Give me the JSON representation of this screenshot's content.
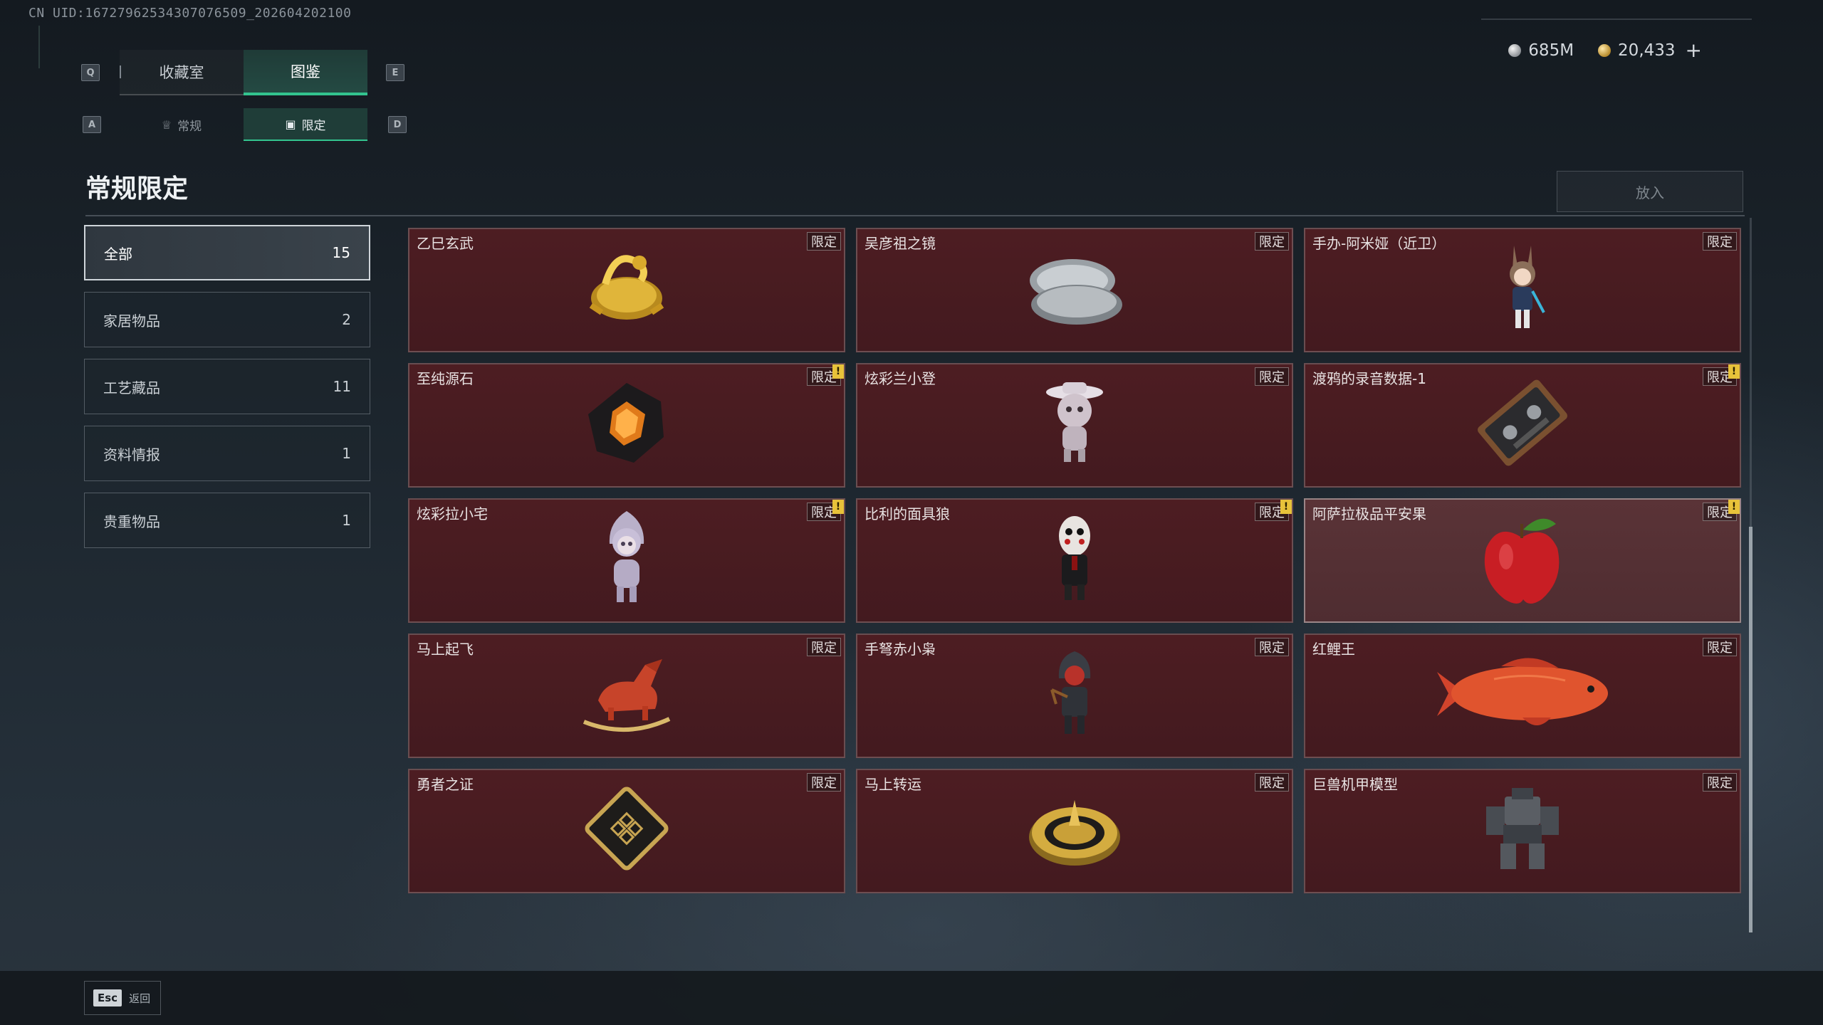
{
  "uid_text": "CN UID:16727962534307076509⁠⁠_202604202100",
  "currency": {
    "silver": "685M",
    "gold": "20,433",
    "add": "+"
  },
  "keys": {
    "prev_tab": "Q",
    "next_tab": "E",
    "prev_sub": "A",
    "next_sub": "D"
  },
  "main_tabs": [
    {
      "label": "收藏室"
    },
    {
      "label": "图鉴"
    }
  ],
  "sub_tabs": [
    {
      "label": "常规",
      "icon": "trophy-icon"
    },
    {
      "label": "限定",
      "icon": "picture-icon"
    }
  ],
  "heading": "常规限定",
  "put_button": "放入",
  "categories": [
    {
      "label": "全部",
      "count": "15"
    },
    {
      "label": "家居物品",
      "count": "2"
    },
    {
      "label": "工艺藏品",
      "count": "11"
    },
    {
      "label": "资料情报",
      "count": "1"
    },
    {
      "label": "贵重物品",
      "count": "1"
    }
  ],
  "tag_label": "限定",
  "warn_mark": "!",
  "items": [
    {
      "name": "乙巳玄武",
      "icon": "gold-dragon-icon",
      "warn": false
    },
    {
      "name": "吴彦祖之镜",
      "icon": "compact-mirror-icon",
      "warn": false
    },
    {
      "name": "手办-阿米娅（近卫）",
      "icon": "figure-amiya-icon",
      "warn": false
    },
    {
      "name": "至纯源石",
      "icon": "source-stone-icon",
      "warn": true
    },
    {
      "name": "炫彩兰小登",
      "icon": "figure-hat-icon",
      "warn": false
    },
    {
      "name": "渡鸦的录音数据-1",
      "icon": "cassette-icon",
      "warn": true
    },
    {
      "name": "炫彩拉小宅",
      "icon": "figure-hood-icon",
      "warn": true
    },
    {
      "name": "比利的面具狼",
      "icon": "puppet-mask-icon",
      "warn": true
    },
    {
      "name": "阿萨拉极品平安果",
      "icon": "apple-icon",
      "warn": true
    },
    {
      "name": "马上起飞",
      "icon": "rocking-horse-icon",
      "warn": false
    },
    {
      "name": "手弩赤小枭",
      "icon": "figure-crossbow-icon",
      "warn": false
    },
    {
      "name": "红鲤王",
      "icon": "koi-fish-icon",
      "warn": false
    },
    {
      "name": "勇者之证",
      "icon": "badge-card-icon",
      "warn": false
    },
    {
      "name": "马上转运",
      "icon": "golden-wheel-icon",
      "warn": false
    },
    {
      "name": "巨兽机甲模型",
      "icon": "mech-model-icon",
      "warn": false
    }
  ],
  "esc": {
    "key": "Esc",
    "label": "返回"
  }
}
